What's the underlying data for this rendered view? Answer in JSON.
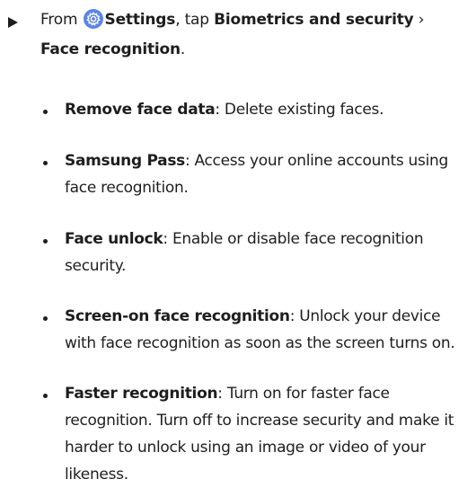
{
  "step": {
    "prefix": "From ",
    "app_name": "Settings",
    "mid": ", tap ",
    "menu_item": "Biometrics and security",
    "chevron": " ›",
    "target": "Face recognition",
    "end": ".",
    "icon": "settings-gear-icon",
    "icon_color": "#5b84e8"
  },
  "bullets": [
    {
      "term": "Remove face data",
      "text": ": Delete existing faces."
    },
    {
      "term": "Samsung Pass",
      "text": ": Access your online accounts using face recognition."
    },
    {
      "term": "Face unlock",
      "text": ": Enable or disable face recognition security."
    },
    {
      "term": "Screen-on face recognition",
      "text": ": Unlock your device with face recognition as soon as the screen turns on."
    },
    {
      "term": "Faster recognition",
      "text": ": Turn on for faster face recognition. Turn off to increase security and make it harder to unlock using an image or video of your likeness."
    }
  ]
}
